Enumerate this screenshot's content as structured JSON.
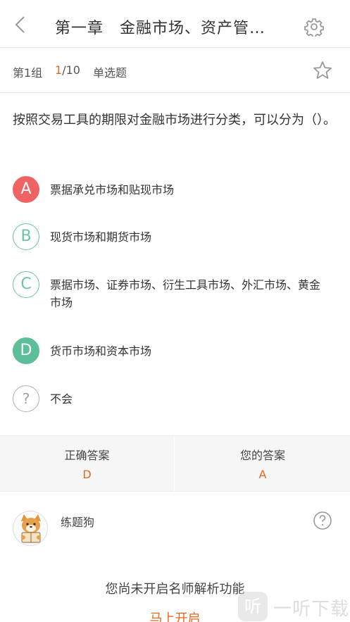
{
  "header": {
    "title": "第一章　金融市场、资产管…",
    "back_icon": "chevron-left-icon",
    "settings_icon": "gear-icon"
  },
  "subbar": {
    "group": "第1组",
    "current": "1",
    "total": "/10",
    "type": "单选题",
    "favorite_icon": "star-outline-icon"
  },
  "question": {
    "text": "按照交易工具的期限对金融市场进行分类，可以分为（）。"
  },
  "options": [
    {
      "key": "A",
      "text": "票据承兑市场和贴现市场",
      "state": "wrong"
    },
    {
      "key": "B",
      "text": "现货市场和期货市场",
      "state": "normal"
    },
    {
      "key": "C",
      "text": "票据市场、证券市场、衍生工具市场、外汇市场、黄金市场",
      "state": "normal"
    },
    {
      "key": "D",
      "text": "货币市场和资本市场",
      "state": "correct"
    },
    {
      "key": "?",
      "text": "不会",
      "state": "unknown"
    }
  ],
  "answers": {
    "correct_label": "正确答案",
    "correct_value": "D",
    "yours_label": "您的答案",
    "yours_value": "A"
  },
  "analysis": {
    "author": "练题狗",
    "help_icon": "question-circle-icon",
    "notice": "您尚未开启名师解析功能",
    "open_link": "马上开启"
  },
  "watermark": {
    "badge": "听",
    "text": "一听下载"
  },
  "colors": {
    "accent": "#e8671e",
    "wrong": "#f06363",
    "correct": "#5dbf97",
    "outline": "#6cc4a4"
  }
}
